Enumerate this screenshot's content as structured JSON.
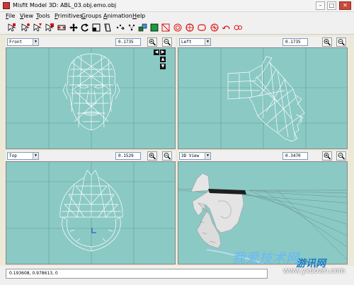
{
  "window": {
    "title": "Misfit Model 3D: ABL_03.obj.emo.obj",
    "minimize": "–",
    "maximize": "□",
    "close": "✕"
  },
  "menu": [
    {
      "label": "File",
      "mnemonic": "F",
      "rest": "ile"
    },
    {
      "label": "View",
      "mnemonic": "V",
      "rest": "iew"
    },
    {
      "label": "Tools",
      "mnemonic": "T",
      "rest": "ools"
    },
    {
      "label": "Primitives",
      "mnemonic": "P",
      "rest": "rimitives"
    },
    {
      "label": "Groups",
      "mnemonic": "G",
      "rest": "roups"
    },
    {
      "label": "Animation",
      "mnemonic": "A",
      "rest": "nimation"
    },
    {
      "label": "Help",
      "mnemonic": "H",
      "rest": "elp"
    }
  ],
  "toolbar": {
    "icons": [
      "select-icon",
      "select-vertex-icon",
      "select-face-icon",
      "select-group-icon",
      "select-bone-icon",
      "move-icon",
      "rotate-icon",
      "scale-icon",
      "shear-icon",
      "extrude-icon",
      "attract-icon",
      "bone-icon",
      "cube-icon",
      "ellipsoid-icon",
      "torus-icon",
      "cylinder-icon",
      "polygon-icon",
      "text-icon",
      "drag-vertex-icon",
      "background-icon"
    ]
  },
  "viewports": {
    "front": {
      "view": "Front",
      "zoom": "0.1735"
    },
    "left": {
      "view": "Left",
      "zoom": "0.1735"
    },
    "top": {
      "view": "Top",
      "zoom": "0.1529"
    },
    "view3d": {
      "view": "3D View",
      "zoom": "0.3470"
    }
  },
  "status": {
    "coords": "0.193608, 0.978613, 0"
  },
  "watermark": {
    "line1": "我爱技术网",
    "line2": "www.yxdown.com",
    "brand": "游讯网"
  },
  "colors": {
    "viewport_bg": "#8bc9c4",
    "grid": "#5f9f9a",
    "wire": "#ffffff"
  }
}
